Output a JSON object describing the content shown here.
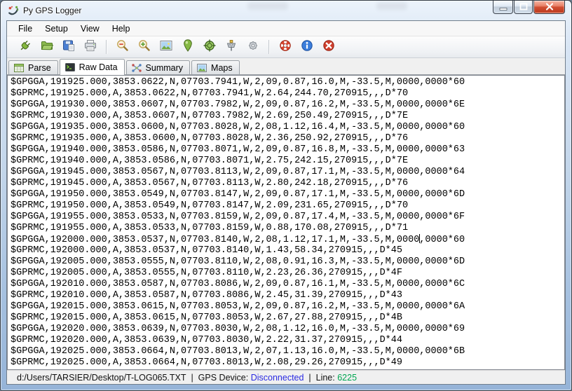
{
  "window": {
    "title": "Py GPS Logger",
    "controls": [
      {
        "name": "minimize"
      },
      {
        "name": "maximize"
      },
      {
        "name": "close"
      }
    ]
  },
  "menu": {
    "items": [
      "File",
      "Setup",
      "View",
      "Help"
    ]
  },
  "toolbar": {
    "groups": [
      [
        "connect",
        "open-file",
        "save",
        "print"
      ],
      [
        "zoom-out",
        "zoom-in",
        "view-image",
        "map-marker",
        "center-target",
        "gps-device",
        "settings"
      ],
      [
        "help",
        "about-info",
        "exit"
      ]
    ]
  },
  "tabs": {
    "items": [
      {
        "label": "Parse",
        "icon": "parse-table",
        "active": false
      },
      {
        "label": "Raw Data",
        "icon": "raw-terminal",
        "active": true
      },
      {
        "label": "Summary",
        "icon": "summary-graph",
        "active": false
      },
      {
        "label": "Maps",
        "icon": "maps-image",
        "active": false
      }
    ]
  },
  "raw_log": {
    "caret": {
      "line_index": 14,
      "column": 72
    },
    "lines": [
      "$GPGGA,191925.000,3853.0622,N,07703.7941,W,2,09,0.87,16.0,M,-33.5,M,0000,0000*60",
      "$GPRMC,191925.000,A,3853.0622,N,07703.7941,W,2.64,244.70,270915,,,D*70",
      "$GPGGA,191930.000,3853.0607,N,07703.7982,W,2,09,0.87,16.2,M,-33.5,M,0000,0000*6E",
      "$GPRMC,191930.000,A,3853.0607,N,07703.7982,W,2.69,250.49,270915,,,D*7E",
      "$GPGGA,191935.000,3853.0600,N,07703.8028,W,2,08,1.12,16.4,M,-33.5,M,0000,0000*60",
      "$GPRMC,191935.000,A,3853.0600,N,07703.8028,W,2.36,250.92,270915,,,D*76",
      "$GPGGA,191940.000,3853.0586,N,07703.8071,W,2,09,0.87,16.8,M,-33.5,M,0000,0000*63",
      "$GPRMC,191940.000,A,3853.0586,N,07703.8071,W,2.75,242.15,270915,,,D*7E",
      "$GPGGA,191945.000,3853.0567,N,07703.8113,W,2,09,0.87,17.1,M,-33.5,M,0000,0000*64",
      "$GPRMC,191945.000,A,3853.0567,N,07703.8113,W,2.80,242.18,270915,,,D*76",
      "$GPGGA,191950.000,3853.0549,N,07703.8147,W,2,09,0.87,17.1,M,-33.5,M,0000,0000*6D",
      "$GPRMC,191950.000,A,3853.0549,N,07703.8147,W,2.09,231.65,270915,,,D*70",
      "$GPGGA,191955.000,3853.0533,N,07703.8159,W,2,09,0.87,17.4,M,-33.5,M,0000,0000*6F",
      "$GPRMC,191955.000,A,3853.0533,N,07703.8159,W,0.88,170.08,270915,,,D*71",
      "$GPGGA,192000.000,3853.0537,N,07703.8140,W,2,08,1.12,17.1,M,-33.5,M,0000,0000*60",
      "$GPRMC,192000.000,A,3853.0537,N,07703.8140,W,1.43,58.34,270915,,,D*45",
      "$GPGGA,192005.000,3853.0555,N,07703.8110,W,2,08,0.91,16.3,M,-33.5,M,0000,0000*6D",
      "$GPRMC,192005.000,A,3853.0555,N,07703.8110,W,2.23,26.36,270915,,,D*4F",
      "$GPGGA,192010.000,3853.0587,N,07703.8086,W,2,09,0.87,16.1,M,-33.5,M,0000,0000*6C",
      "$GPRMC,192010.000,A,3853.0587,N,07703.8086,W,2.45,31.39,270915,,,D*43",
      "$GPGGA,192015.000,3853.0615,N,07703.8053,W,2,09,0.87,16.2,M,-33.5,M,0000,0000*6A",
      "$GPRMC,192015.000,A,3853.0615,N,07703.8053,W,2.67,27.88,270915,,,D*4B",
      "$GPGGA,192020.000,3853.0639,N,07703.8030,W,2,08,1.12,16.0,M,-33.5,M,0000,0000*69",
      "$GPRMC,192020.000,A,3853.0639,N,07703.8030,W,2.22,31.37,270915,,,D*44",
      "$GPGGA,192025.000,3853.0664,N,07703.8013,W,2,07,1.13,16.0,M,-33.5,M,0000,0000*6B",
      "$GPRMC,192025.000,A,3853.0664,N,07703.8013,W,2.08,29.26,270915,,,D*49"
    ]
  },
  "status_bar": {
    "file_path": "d:/Users/TARSIER/Desktop/T-LOG065.TXT",
    "separator": "|",
    "gps_device_label": "GPS Device:",
    "gps_device_status": "Disconnected",
    "line_label": "Line:",
    "line_number": "6225",
    "colors": {
      "gps_status": "#2a2ae2",
      "line_number": "#00a651"
    }
  }
}
